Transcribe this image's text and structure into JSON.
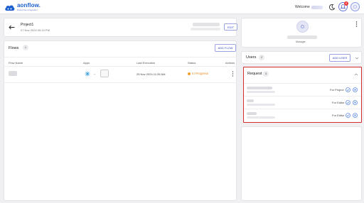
{
  "header": {
    "logo_name": "aonflow.",
    "logo_tagline": "Enterprise Integration",
    "welcome_label": "Welcome",
    "notifications_count": "8"
  },
  "project": {
    "name": "Project1",
    "date": "07 Nov 2024 05:10 PM",
    "edit_label": "EDIT"
  },
  "flows": {
    "title": "Flows",
    "count": "1",
    "add_label": "ADD FLOW",
    "columns": [
      "Flow Name",
      "Apps",
      "Last Execution",
      "Status",
      "Actions"
    ],
    "rows": [
      {
        "last_execution": "25 Nov 2024 11:26 AM",
        "status": "In Progress"
      }
    ]
  },
  "manager": {
    "role_label": "Manager"
  },
  "users": {
    "title": "Users",
    "count": "2",
    "add_label": "ADD USER"
  },
  "requests": {
    "title": "Request",
    "count": "3",
    "items": [
      {
        "label": "For Project"
      },
      {
        "label": "For Editor"
      },
      {
        "label": "For Editor"
      }
    ]
  },
  "colors": {
    "accent": "#3b4cc0",
    "status_in_progress": "#e58a1a",
    "request_highlight": "#d42a2a",
    "approve": "#2f6be0",
    "reject": "#2f6be0"
  }
}
